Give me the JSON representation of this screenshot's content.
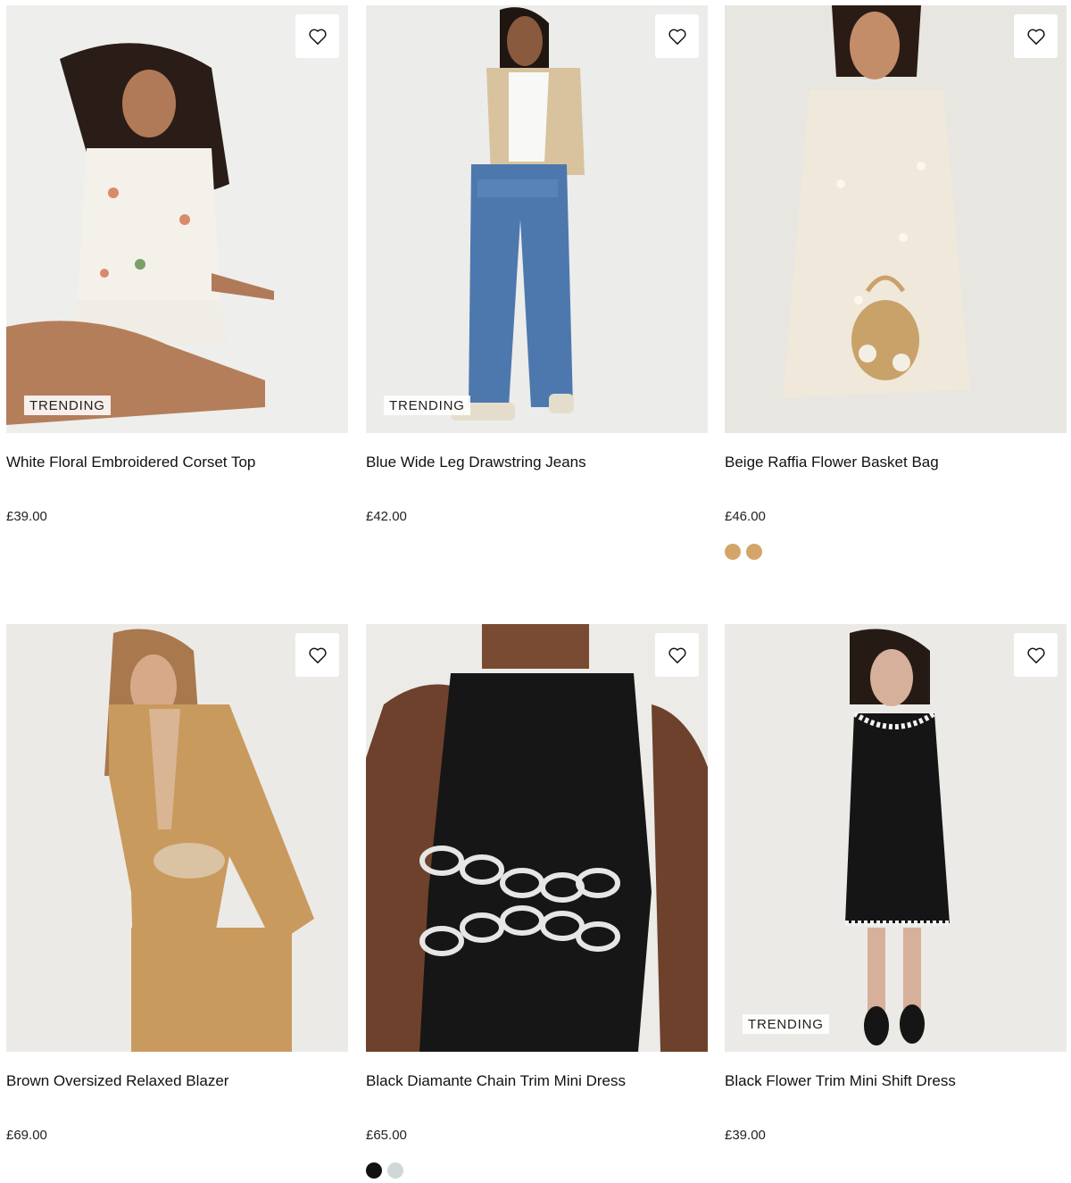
{
  "products": [
    {
      "title": "White Floral Embroidered Corset Top",
      "price": "£39.00",
      "badge": "TRENDING",
      "swatches": []
    },
    {
      "title": "Blue Wide Leg Drawstring Jeans",
      "price": "£42.00",
      "badge": "TRENDING",
      "swatches": []
    },
    {
      "title": "Beige Raffia Flower Basket Bag",
      "price": "£46.00",
      "badge": "",
      "swatches": [
        "#d4a56a",
        "#d4a56a"
      ]
    },
    {
      "title": "Brown Oversized Relaxed Blazer",
      "price": "£69.00",
      "badge": "",
      "swatches": []
    },
    {
      "title": "Black Diamante Chain Trim Mini Dress",
      "price": "£65.00",
      "badge": "",
      "swatches": [
        "#111111",
        "#cfd8d8"
      ]
    },
    {
      "title": "Black Flower Trim Mini Shift Dress",
      "price": "£39.00",
      "badge": "TRENDING",
      "swatches": []
    }
  ],
  "icons": {
    "wishlist": "heart-outline-icon"
  }
}
